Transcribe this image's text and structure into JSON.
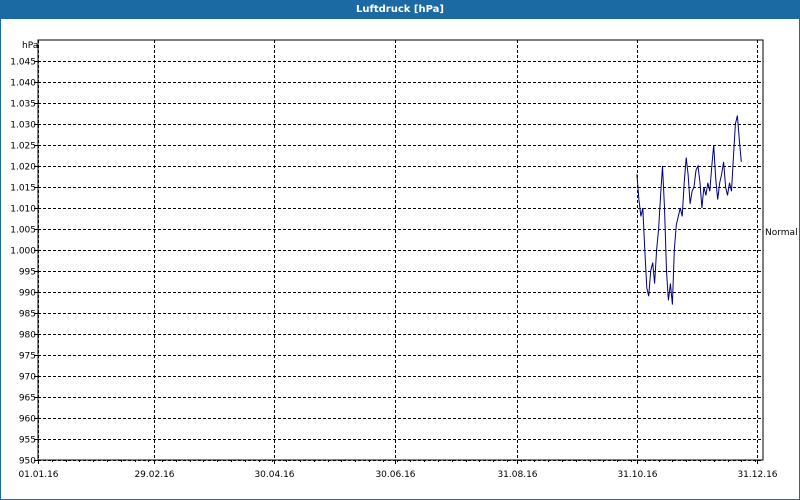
{
  "window": {
    "title": "Luftdruck [hPa]"
  },
  "chart_data": {
    "type": "line",
    "title": "Luftdruck [hPa]",
    "ylabel": "hPa",
    "xlabel": "",
    "ylim": [
      950,
      1050
    ],
    "xlim": [
      "2016-01-01",
      "2017-01-03"
    ],
    "grid": true,
    "yticks": [
      {
        "value": 950,
        "label": "950"
      },
      {
        "value": 955,
        "label": "955"
      },
      {
        "value": 960,
        "label": "960"
      },
      {
        "value": 965,
        "label": "965"
      },
      {
        "value": 970,
        "label": "970"
      },
      {
        "value": 975,
        "label": "975"
      },
      {
        "value": 980,
        "label": "980"
      },
      {
        "value": 985,
        "label": "985"
      },
      {
        "value": 990,
        "label": "990"
      },
      {
        "value": 995,
        "label": "995"
      },
      {
        "value": 1000,
        "label": "1.000"
      },
      {
        "value": 1005,
        "label": "1.005"
      },
      {
        "value": 1010,
        "label": "1.010"
      },
      {
        "value": 1015,
        "label": "1.015"
      },
      {
        "value": 1020,
        "label": "1.020"
      },
      {
        "value": 1025,
        "label": "1.025"
      },
      {
        "value": 1030,
        "label": "1.030"
      },
      {
        "value": 1035,
        "label": "1.035"
      },
      {
        "value": 1040,
        "label": "1.040"
      },
      {
        "value": 1045,
        "label": "1.045"
      }
    ],
    "xticks": [
      {
        "date": "2016-01-01",
        "label": "01.01.16"
      },
      {
        "date": "2016-02-29",
        "label": "29.02.16"
      },
      {
        "date": "2016-04-30",
        "label": "30.04.16"
      },
      {
        "date": "2016-06-30",
        "label": "30.06.16"
      },
      {
        "date": "2016-08-31",
        "label": "31.08.16"
      },
      {
        "date": "2016-10-31",
        "label": "31.10.16"
      },
      {
        "date": "2016-12-31",
        "label": "31.12.16"
      }
    ],
    "reference_line": {
      "label": "Normal",
      "value": 1005
    },
    "series": [
      {
        "color": "#000080",
        "points": [
          [
            "2016-10-31",
            1018
          ],
          [
            "2016-11-01",
            1012
          ],
          [
            "2016-11-02",
            1008
          ],
          [
            "2016-11-03",
            1010
          ],
          [
            "2016-11-04",
            1000
          ],
          [
            "2016-11-05",
            991
          ],
          [
            "2016-11-06",
            989
          ],
          [
            "2016-11-07",
            995
          ],
          [
            "2016-11-08",
            997
          ],
          [
            "2016-11-09",
            992
          ],
          [
            "2016-11-10",
            1000
          ],
          [
            "2016-11-11",
            1005
          ],
          [
            "2016-11-12",
            1013
          ],
          [
            "2016-11-13",
            1020
          ],
          [
            "2016-11-14",
            1010
          ],
          [
            "2016-11-15",
            995
          ],
          [
            "2016-11-16",
            988
          ],
          [
            "2016-11-17",
            992
          ],
          [
            "2016-11-18",
            987
          ],
          [
            "2016-11-19",
            1000
          ],
          [
            "2016-11-20",
            1006
          ],
          [
            "2016-11-21",
            1008
          ],
          [
            "2016-11-22",
            1010
          ],
          [
            "2016-11-23",
            1008
          ],
          [
            "2016-11-24",
            1016
          ],
          [
            "2016-11-25",
            1022
          ],
          [
            "2016-11-26",
            1018
          ],
          [
            "2016-11-27",
            1011
          ],
          [
            "2016-11-28",
            1014
          ],
          [
            "2016-11-29",
            1015
          ],
          [
            "2016-11-30",
            1019
          ],
          [
            "2016-12-01",
            1020
          ],
          [
            "2016-12-02",
            1016
          ],
          [
            "2016-12-03",
            1010
          ],
          [
            "2016-12-04",
            1015
          ],
          [
            "2016-12-05",
            1013
          ],
          [
            "2016-12-06",
            1016
          ],
          [
            "2016-12-07",
            1014
          ],
          [
            "2016-12-08",
            1020
          ],
          [
            "2016-12-09",
            1025
          ],
          [
            "2016-12-10",
            1017
          ],
          [
            "2016-12-11",
            1012
          ],
          [
            "2016-12-12",
            1016
          ],
          [
            "2016-12-13",
            1018
          ],
          [
            "2016-12-14",
            1021
          ],
          [
            "2016-12-15",
            1015
          ],
          [
            "2016-12-16",
            1013
          ],
          [
            "2016-12-17",
            1016
          ],
          [
            "2016-12-18",
            1014
          ],
          [
            "2016-12-19",
            1022
          ],
          [
            "2016-12-20",
            1030
          ],
          [
            "2016-12-21",
            1032
          ],
          [
            "2016-12-22",
            1026
          ],
          [
            "2016-12-23",
            1021
          ]
        ]
      }
    ]
  }
}
